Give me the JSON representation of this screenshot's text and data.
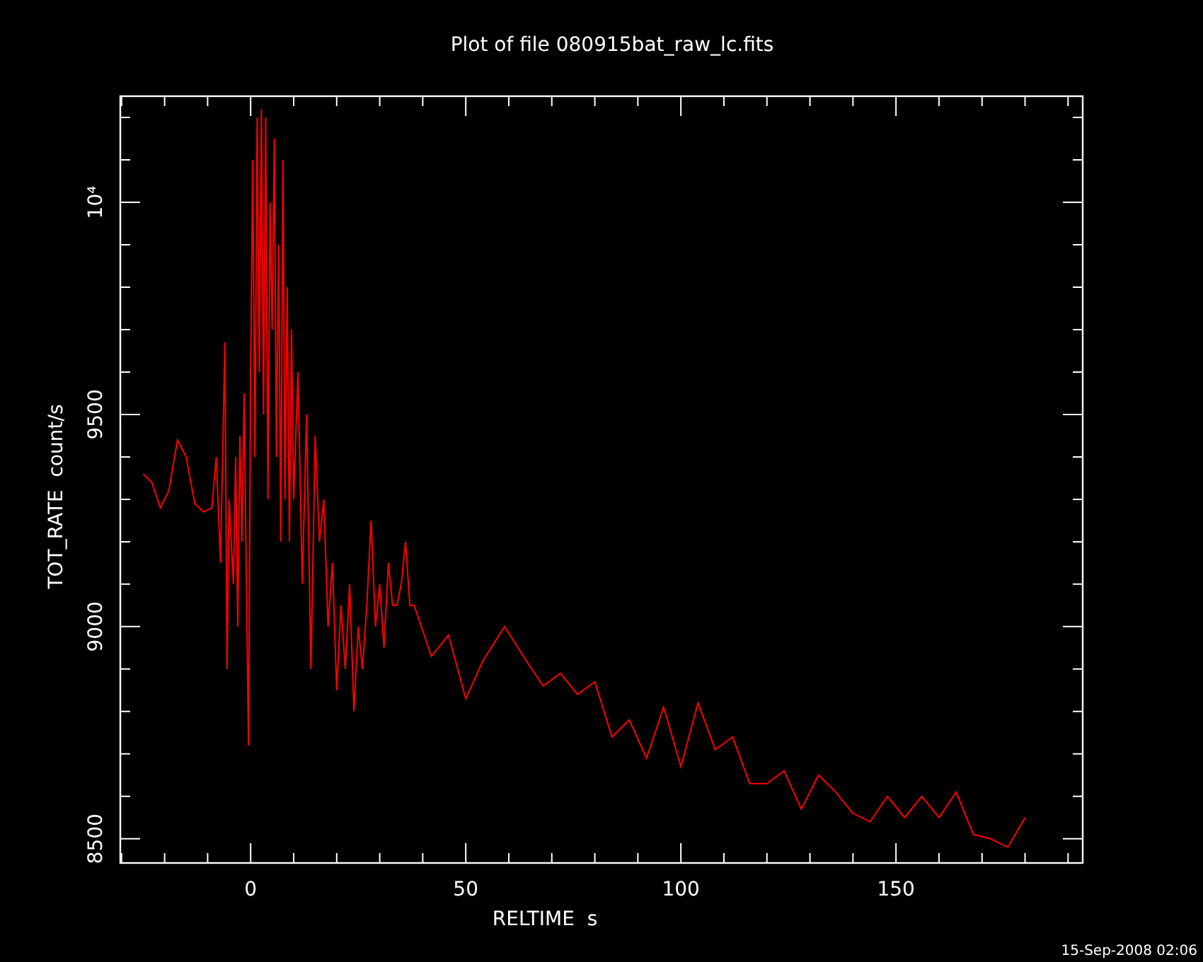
{
  "title": "Plot of file 080915bat_raw_lc.fits",
  "chart": {
    "chart_data": {
      "type": "line",
      "xlabel": "RELTIME  s",
      "ylabel": "TOT_RATE  count/s",
      "xlim": [
        -30.3,
        193.4
      ],
      "ylim": [
        8443,
        10250
      ],
      "xticks": [
        0,
        50,
        100,
        150
      ],
      "yticks": [
        8500,
        9000,
        9500,
        {
          "value": 10000,
          "label": "10⁴"
        }
      ],
      "x": [
        -25,
        -23,
        -21,
        -19,
        -17,
        -15,
        -13,
        -11,
        -9,
        -8,
        -7,
        -6,
        -5.5,
        -5,
        -4,
        -3.5,
        -3,
        -2.5,
        -2,
        -1.5,
        -1,
        -0.5,
        0,
        0.5,
        1,
        1.5,
        2,
        2.5,
        3,
        3.5,
        4,
        4.5,
        5,
        5.5,
        6,
        6.5,
        7,
        7.5,
        8,
        8.5,
        9,
        9.5,
        10,
        11,
        12,
        13,
        14,
        15,
        16,
        17,
        18,
        19,
        20,
        21,
        22,
        23,
        24,
        25,
        26,
        27,
        28,
        29,
        30,
        31,
        32,
        33,
        34,
        35,
        36,
        37,
        38,
        42,
        46,
        50,
        54,
        59,
        64,
        68,
        72,
        76,
        80,
        84,
        88,
        92,
        96,
        100,
        104,
        108,
        112,
        116,
        120,
        124,
        128,
        132,
        136,
        140,
        144,
        148,
        152,
        156,
        160,
        164,
        168,
        172,
        176,
        180
      ],
      "series": [
        {
          "color": "#ff0000",
          "values": [
            9360,
            9340,
            9280,
            9320,
            9440,
            9400,
            9290,
            9270,
            9280,
            9400,
            9150,
            9670,
            8900,
            9300,
            9100,
            9400,
            9000,
            9450,
            9200,
            9550,
            9100,
            8720,
            9600,
            10100,
            9400,
            10200,
            9600,
            10220,
            9500,
            10200,
            9300,
            10000,
            9700,
            10150,
            9400,
            9900,
            9200,
            10100,
            9300,
            9800,
            9200,
            9700,
            9300,
            9600,
            9100,
            9500,
            8900,
            9450,
            9200,
            9300,
            9000,
            9150,
            8850,
            9050,
            8900,
            9100,
            8800,
            9000,
            8900,
            9050,
            9250,
            9000,
            9100,
            8950,
            9150,
            9050,
            9050,
            9100,
            9200,
            9050,
            9050,
            8930,
            8980,
            8830,
            8920,
            9000,
            8920,
            8860,
            8890,
            8840,
            8870,
            8740,
            8780,
            8690,
            8810,
            8670,
            8820,
            8710,
            8740,
            8630,
            8630,
            8660,
            8570,
            8650,
            8610,
            8560,
            8540,
            8600,
            8550,
            8600,
            8550,
            8610,
            8510,
            8500,
            8480,
            8550
          ]
        }
      ]
    }
  },
  "timestamp": "15-Sep-2008 02:06"
}
